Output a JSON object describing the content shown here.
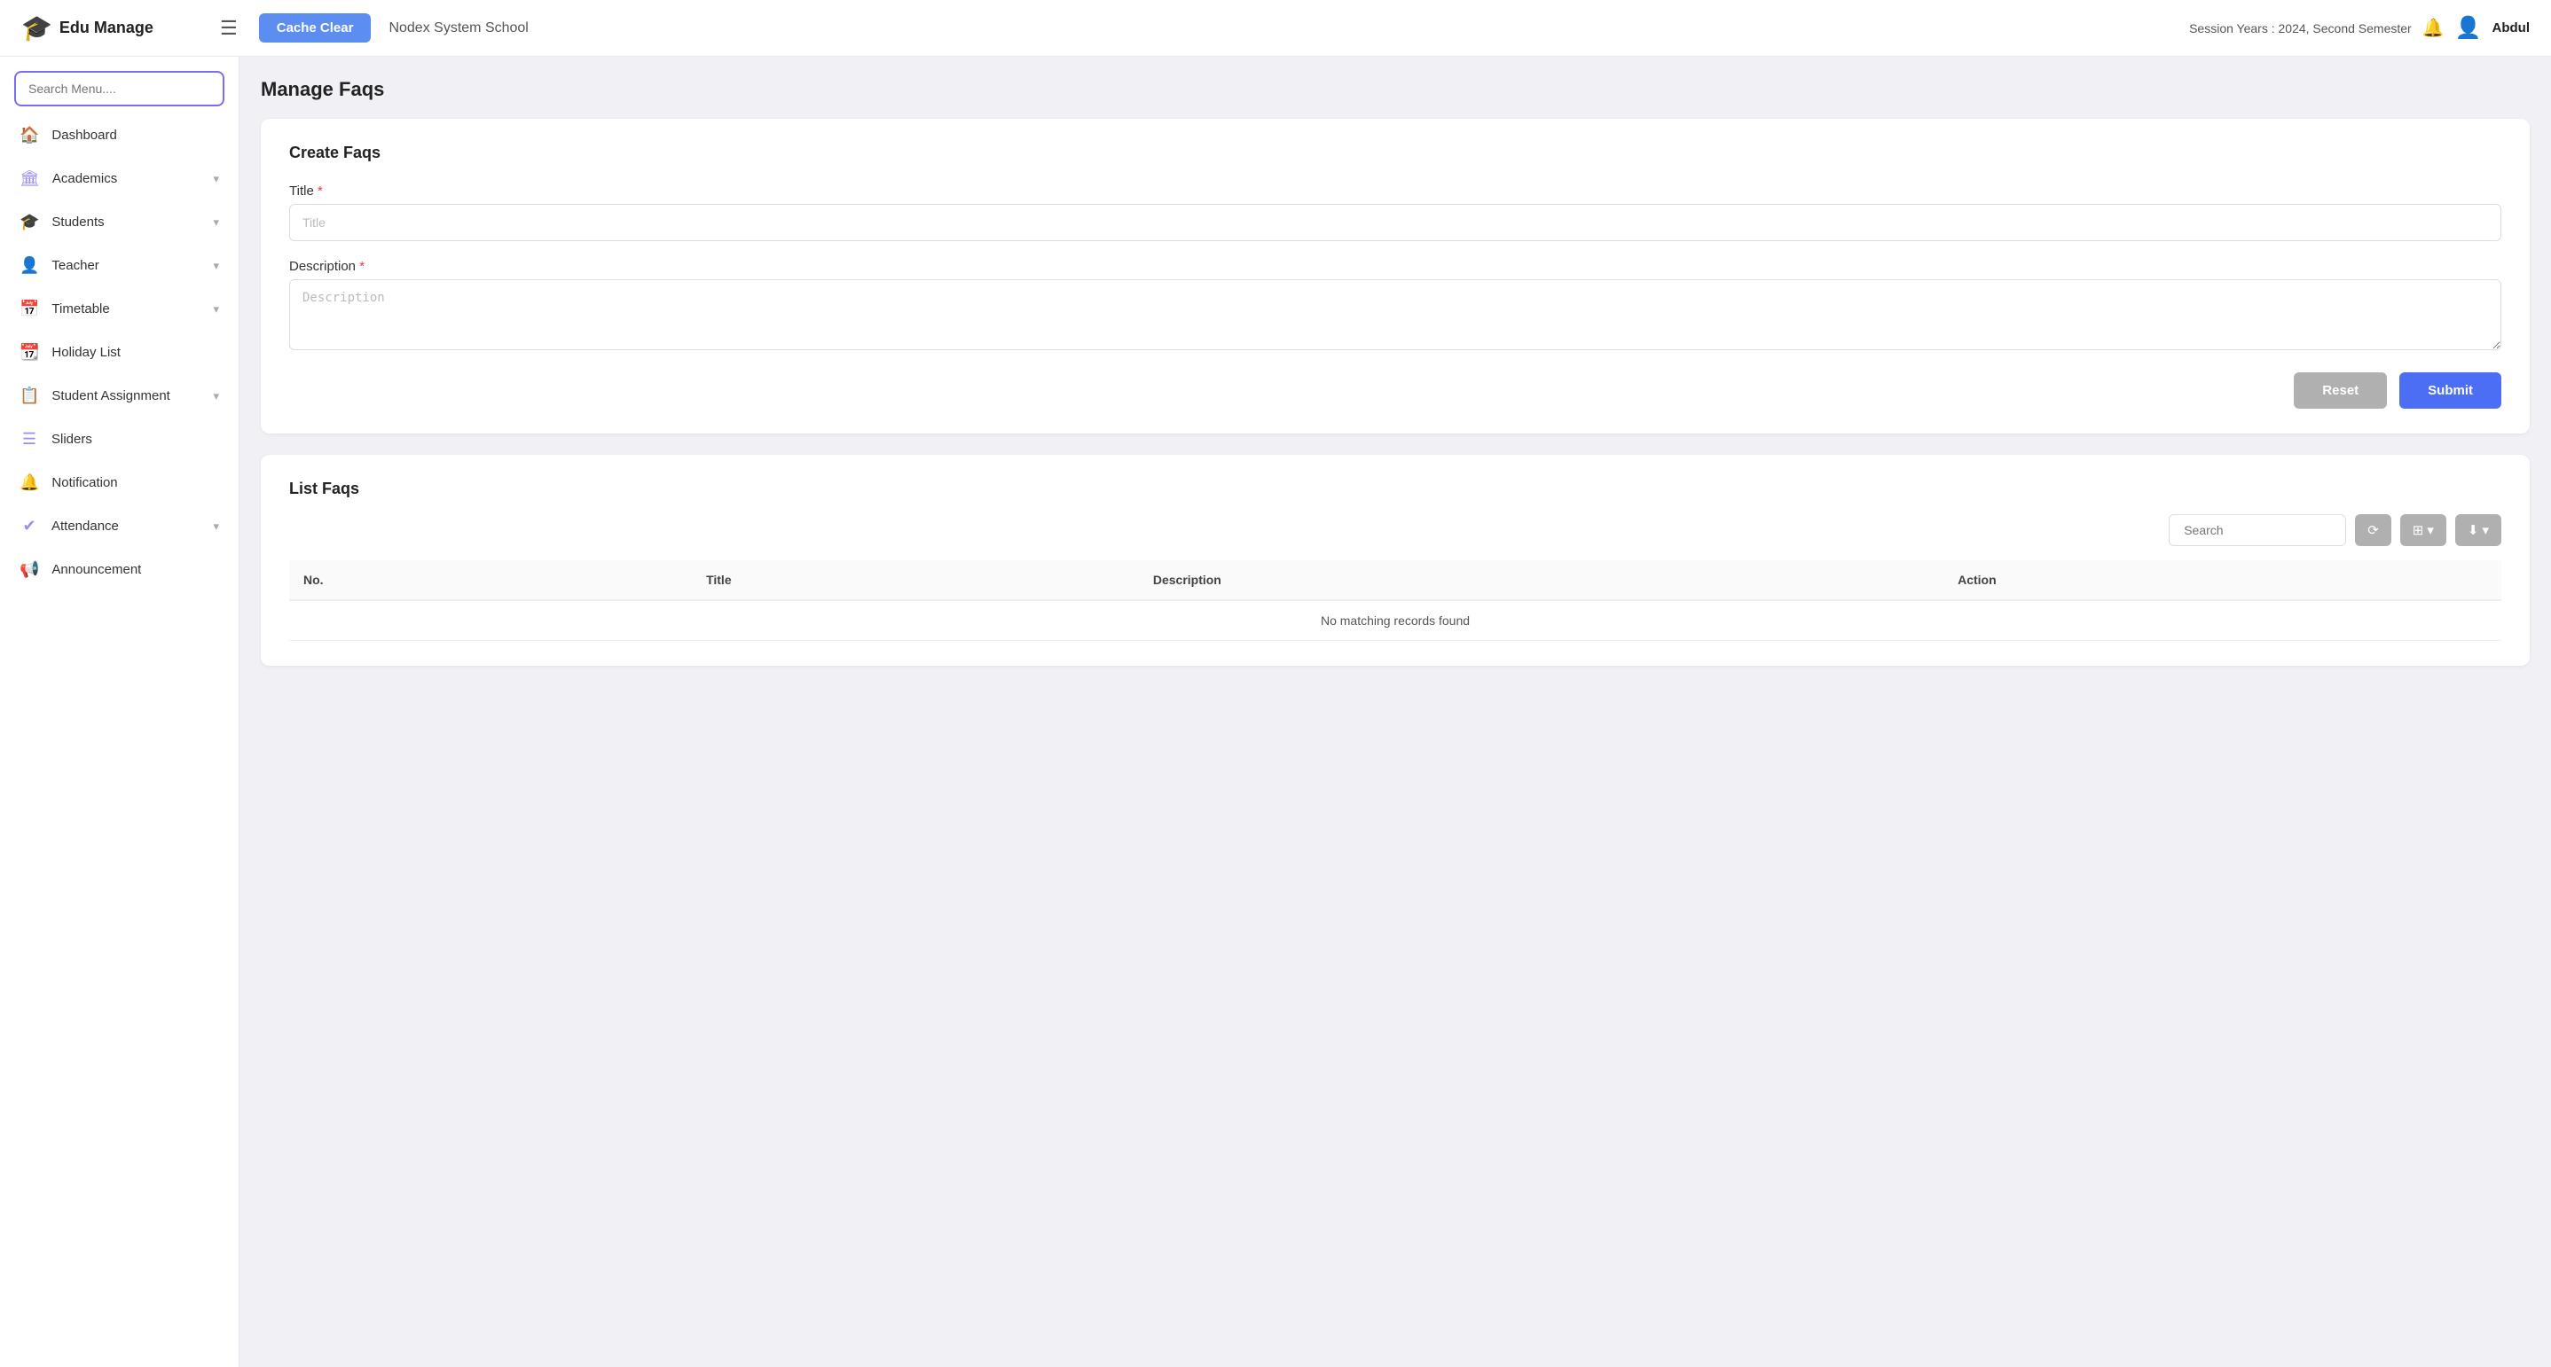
{
  "topnav": {
    "logo_icon": "🎓",
    "logo_text": "Edu Manage",
    "hamburger_label": "☰",
    "cache_clear_label": "Cache Clear",
    "school_name": "Nodex System School",
    "session_info": "Session Years : 2024, Second Semester",
    "notification_icon": "🔔",
    "user_name": "Abdul"
  },
  "sidebar": {
    "search_placeholder": "Search Menu....",
    "items": [
      {
        "id": "dashboard",
        "label": "Dashboard",
        "icon": "🏠",
        "has_chevron": false
      },
      {
        "id": "academics",
        "label": "Academics",
        "icon": "🏛",
        "has_chevron": true
      },
      {
        "id": "students",
        "label": "Students",
        "icon": "🎓",
        "has_chevron": true
      },
      {
        "id": "teacher",
        "label": "Teacher",
        "icon": "👤",
        "has_chevron": true
      },
      {
        "id": "timetable",
        "label": "Timetable",
        "icon": "📅",
        "has_chevron": true
      },
      {
        "id": "holiday-list",
        "label": "Holiday List",
        "icon": "📆",
        "has_chevron": false
      },
      {
        "id": "student-assignment",
        "label": "Student Assignment",
        "icon": "📋",
        "has_chevron": true
      },
      {
        "id": "sliders",
        "label": "Sliders",
        "icon": "☰",
        "has_chevron": false
      },
      {
        "id": "notification",
        "label": "Notification",
        "icon": "🔔",
        "has_chevron": false
      },
      {
        "id": "attendance",
        "label": "Attendance",
        "icon": "✔",
        "has_chevron": true
      },
      {
        "id": "announcement",
        "label": "Announcement",
        "icon": "📢",
        "has_chevron": false
      }
    ]
  },
  "main": {
    "page_title": "Manage Faqs",
    "create_section": {
      "title": "Create Faqs",
      "title_label": "Title",
      "title_required": true,
      "title_placeholder": "Title",
      "description_label": "Description",
      "description_required": true,
      "description_placeholder": "Description",
      "reset_label": "Reset",
      "submit_label": "Submit"
    },
    "list_section": {
      "title": "List Faqs",
      "search_placeholder": "Search",
      "refresh_icon": "⟳",
      "columns_icon": "⊞",
      "download_icon": "⬇",
      "table": {
        "columns": [
          "No.",
          "Title",
          "Description",
          "Action"
        ],
        "no_records_text": "No matching records found"
      }
    }
  }
}
